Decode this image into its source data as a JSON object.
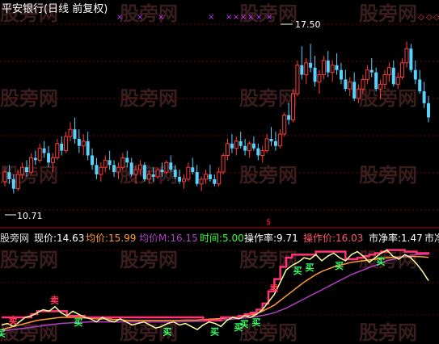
{
  "chart_data": [
    {
      "type": "candlestick",
      "title": "平安银行(日线 前复权)",
      "annotations": {
        "high_label": "17.50",
        "low_label": "10.71",
        "high_value": 17.5,
        "low_value": 10.71
      },
      "ylim": [
        10.3,
        18.6
      ],
      "top_markers": [
        "×",
        "×",
        "×",
        "×",
        "×",
        "×",
        "×",
        "×",
        "×",
        "×",
        "◇",
        "◇",
        "◇"
      ],
      "candles": [
        [
          11.7,
          12.3,
          11.5,
          12.1
        ],
        [
          12.1,
          12.4,
          11.6,
          11.8
        ],
        [
          11.8,
          12.0,
          11.2,
          11.4
        ],
        [
          11.4,
          12.2,
          11.3,
          12.0
        ],
        [
          12.0,
          12.5,
          11.8,
          12.3
        ],
        [
          12.3,
          12.6,
          11.9,
          12.1
        ],
        [
          12.1,
          12.9,
          12.0,
          12.7
        ],
        [
          12.7,
          13.0,
          12.4,
          12.6
        ],
        [
          12.6,
          13.3,
          12.5,
          13.1
        ],
        [
          13.1,
          13.4,
          12.7,
          12.9
        ],
        [
          12.9,
          13.2,
          12.3,
          12.5
        ],
        [
          12.5,
          12.9,
          12.1,
          12.7
        ],
        [
          12.7,
          13.5,
          12.6,
          13.3
        ],
        [
          13.3,
          13.6,
          12.8,
          13.0
        ],
        [
          13.0,
          13.8,
          12.9,
          13.6
        ],
        [
          13.6,
          14.2,
          13.4,
          13.9
        ],
        [
          13.9,
          14.4,
          13.3,
          13.5
        ],
        [
          13.5,
          13.9,
          12.9,
          13.2
        ],
        [
          13.2,
          13.7,
          12.8,
          13.4
        ],
        [
          13.4,
          13.8,
          12.6,
          12.8
        ],
        [
          12.8,
          13.1,
          12.2,
          12.4
        ],
        [
          12.4,
          12.7,
          11.8,
          12.0
        ],
        [
          12.0,
          12.5,
          11.7,
          12.3
        ],
        [
          12.3,
          12.8,
          12.1,
          12.6
        ],
        [
          12.6,
          13.0,
          12.2,
          12.4
        ],
        [
          12.4,
          12.6,
          11.9,
          12.1
        ],
        [
          12.1,
          12.5,
          11.8,
          12.3
        ],
        [
          12.3,
          12.9,
          12.2,
          12.7
        ],
        [
          12.7,
          13.0,
          12.3,
          12.5
        ],
        [
          12.5,
          12.7,
          11.9,
          12.0
        ],
        [
          12.0,
          12.4,
          11.6,
          12.2
        ],
        [
          12.2,
          12.6,
          12.0,
          12.4
        ],
        [
          12.4,
          12.5,
          11.7,
          11.8
        ],
        [
          11.8,
          12.2,
          11.6,
          12.0
        ],
        [
          12.0,
          12.3,
          11.7,
          11.9
        ],
        [
          11.9,
          12.3,
          11.8,
          12.2
        ],
        [
          12.2,
          12.5,
          11.9,
          12.1
        ],
        [
          12.1,
          12.6,
          12.0,
          12.5
        ],
        [
          12.5,
          12.8,
          12.1,
          12.2
        ],
        [
          12.2,
          12.4,
          11.8,
          11.9
        ],
        [
          11.9,
          12.2,
          11.6,
          11.7
        ],
        [
          11.7,
          12.0,
          11.4,
          11.8
        ],
        [
          11.8,
          12.5,
          11.7,
          12.3
        ],
        [
          12.3,
          12.7,
          12.0,
          12.1
        ],
        [
          12.1,
          12.4,
          11.5,
          11.6
        ],
        [
          11.6,
          11.9,
          11.3,
          11.8
        ],
        [
          11.8,
          12.2,
          11.6,
          12.0
        ],
        [
          12.0,
          12.4,
          11.7,
          11.8
        ],
        [
          11.8,
          12.0,
          11.5,
          11.6
        ],
        [
          11.6,
          12.3,
          11.5,
          12.1
        ],
        [
          12.1,
          12.9,
          12.0,
          12.8
        ],
        [
          12.8,
          13.5,
          12.6,
          13.3
        ],
        [
          13.3,
          13.7,
          12.9,
          13.1
        ],
        [
          13.1,
          13.6,
          12.8,
          13.4
        ],
        [
          13.4,
          13.8,
          13.1,
          13.2
        ],
        [
          13.2,
          13.5,
          12.8,
          13.0
        ],
        [
          13.0,
          13.4,
          12.7,
          13.3
        ],
        [
          13.3,
          13.6,
          13.0,
          13.1
        ],
        [
          13.1,
          13.3,
          12.6,
          12.8
        ],
        [
          12.8,
          13.2,
          12.5,
          13.0
        ],
        [
          13.0,
          13.7,
          12.9,
          13.5
        ],
        [
          13.5,
          14.0,
          13.2,
          13.4
        ],
        [
          13.4,
          13.8,
          13.0,
          13.2
        ],
        [
          13.2,
          13.9,
          13.1,
          13.7
        ],
        [
          13.7,
          14.6,
          13.6,
          14.5
        ],
        [
          14.5,
          15.0,
          14.1,
          14.3
        ],
        [
          14.3,
          15.6,
          14.2,
          15.4
        ],
        [
          15.4,
          16.8,
          15.3,
          16.6
        ],
        [
          16.6,
          17.4,
          16.0,
          16.2
        ],
        [
          16.2,
          16.9,
          15.8,
          16.7
        ],
        [
          16.7,
          17.5,
          16.3,
          16.5
        ],
        [
          16.5,
          17.0,
          15.7,
          15.9
        ],
        [
          15.9,
          16.4,
          15.4,
          16.2
        ],
        [
          16.2,
          17.0,
          16.0,
          16.8
        ],
        [
          16.8,
          17.2,
          16.1,
          16.3
        ],
        [
          16.3,
          16.8,
          15.9,
          16.6
        ],
        [
          16.6,
          17.1,
          16.2,
          16.4
        ],
        [
          16.4,
          16.7,
          15.8,
          16.0
        ],
        [
          16.0,
          16.4,
          15.5,
          15.6
        ],
        [
          15.6,
          16.1,
          15.3,
          15.9
        ],
        [
          15.9,
          16.3,
          15.1,
          15.2
        ],
        [
          15.2,
          15.8,
          15.0,
          15.6
        ],
        [
          15.6,
          16.2,
          15.4,
          16.0
        ],
        [
          16.0,
          16.6,
          15.8,
          16.4
        ],
        [
          16.4,
          16.9,
          16.1,
          16.3
        ],
        [
          16.3,
          16.5,
          15.5,
          15.6
        ],
        [
          15.6,
          16.0,
          15.2,
          15.8
        ],
        [
          15.8,
          16.4,
          15.6,
          16.2
        ],
        [
          16.2,
          16.7,
          15.9,
          16.5
        ],
        [
          16.5,
          16.8,
          15.7,
          15.8
        ],
        [
          15.8,
          16.3,
          15.6,
          16.1
        ],
        [
          16.1,
          16.9,
          16.0,
          16.7
        ],
        [
          16.7,
          17.6,
          16.5,
          17.3
        ],
        [
          17.3,
          17.5,
          16.3,
          16.4
        ],
        [
          16.4,
          16.8,
          15.8,
          16.0
        ],
        [
          16.0,
          16.4,
          15.4,
          15.5
        ],
        [
          15.5,
          15.9,
          14.8,
          15.0
        ],
        [
          15.0,
          15.3,
          14.2,
          14.4
        ]
      ]
    },
    {
      "type": "line",
      "ylim": [
        12.0,
        17.6
      ],
      "legend": [
        {
          "label": "股旁网",
          "value": "",
          "color": "#e0e0e0"
        },
        {
          "label": "现价:",
          "value": "14.63",
          "color": "#ffffff"
        },
        {
          "label": "均价:",
          "value": "15.99",
          "color": "#ff9a33"
        },
        {
          "label": "均价M:",
          "value": "16.15",
          "color": "#b040c0"
        },
        {
          "label": "时间:",
          "value": "5.00",
          "color": "#33ff33"
        },
        {
          "label": "操作率:",
          "value": "9.71",
          "color": "#ffffff"
        },
        {
          "label": "操作价:",
          "value": "16.03",
          "color": "#ff5566"
        },
        {
          "label": "市净率:",
          "value": "1.47",
          "color": "#ffffff"
        },
        {
          "label": "市净",
          "value": "",
          "color": "#ffffff"
        }
      ],
      "series": [
        {
          "name": "现价",
          "color": "#ffff99",
          "values": [
            12.4,
            12.5,
            12.3,
            12.6,
            12.9,
            13.0,
            13.2,
            13.4,
            13.3,
            13.6,
            13.2,
            13.0,
            13.3,
            13.1,
            12.9,
            12.8,
            12.6,
            12.9,
            12.7,
            12.6,
            12.8,
            12.6,
            12.4,
            12.5,
            12.6,
            12.4,
            12.2,
            12.3,
            12.5,
            12.6,
            12.4,
            12.5,
            12.3,
            12.1,
            12.4,
            12.6,
            12.5,
            12.3,
            12.7,
            12.9,
            12.8,
            13.0,
            12.9,
            13.1,
            13.4,
            13.9,
            14.4,
            15.2,
            16.0,
            16.3,
            16.5,
            16.8,
            16.7,
            17.0,
            16.6,
            16.9,
            17.1,
            16.8,
            16.6,
            17.0,
            17.2,
            16.9,
            16.5,
            16.8,
            17.1,
            17.3,
            16.9,
            16.7,
            17.0,
            16.8,
            16.4,
            15.9,
            15.3
          ]
        },
        {
          "name": "均价",
          "color": "#ff9a33",
          "values": [
            12.1,
            12.2,
            12.3,
            12.4,
            12.5,
            12.6,
            12.7,
            12.75,
            12.8,
            12.85,
            12.9,
            12.9,
            12.9,
            12.9,
            12.85,
            12.85,
            12.8,
            12.8,
            12.8,
            12.75,
            12.75,
            12.7,
            12.7,
            12.7,
            12.7,
            12.7,
            12.7,
            12.7,
            12.7,
            12.7,
            12.7,
            12.72,
            12.72,
            12.72,
            12.75,
            12.78,
            12.8,
            12.82,
            12.85,
            12.9,
            12.95,
            13.0,
            13.05,
            13.15,
            13.3,
            13.5,
            13.7,
            14.0,
            14.3,
            14.6,
            14.9,
            15.2,
            15.45,
            15.7,
            15.9,
            16.05,
            16.2,
            16.3,
            16.4,
            16.5,
            16.55,
            16.6,
            16.65,
            16.7,
            16.75,
            16.8,
            16.82,
            16.85,
            16.87,
            16.88,
            16.88,
            16.86,
            16.82
          ]
        },
        {
          "name": "均价M",
          "color": "#b040c0",
          "values": [
            12.0,
            12.05,
            12.1,
            12.15,
            12.2,
            12.25,
            12.3,
            12.35,
            12.4,
            12.45,
            12.5,
            12.52,
            12.55,
            12.57,
            12.58,
            12.6,
            12.6,
            12.6,
            12.6,
            12.6,
            12.6,
            12.6,
            12.6,
            12.6,
            12.6,
            12.6,
            12.6,
            12.6,
            12.6,
            12.6,
            12.6,
            12.62,
            12.63,
            12.64,
            12.65,
            12.67,
            12.7,
            12.72,
            12.75,
            12.78,
            12.82,
            12.86,
            12.9,
            12.95,
            13.02,
            13.1,
            13.2,
            13.35,
            13.5,
            13.7,
            13.9,
            14.1,
            14.3,
            14.5,
            14.7,
            14.9,
            15.1,
            15.3,
            15.5,
            15.7,
            15.85,
            16.0,
            16.15,
            16.3,
            16.45,
            16.6,
            16.7,
            16.8,
            16.88,
            16.95,
            17.0,
            17.02,
            17.03
          ]
        },
        {
          "name": "操作价",
          "color": "#ff3377",
          "values": [
            12.9,
            12.9,
            12.9,
            12.9,
            12.9,
            13.1,
            13.3,
            13.3,
            13.3,
            13.3,
            13.3,
            13.0,
            13.0,
            13.0,
            12.9,
            12.9,
            12.9,
            12.9,
            12.9,
            12.9,
            12.9,
            12.9,
            12.9,
            12.9,
            12.9,
            12.9,
            12.9,
            12.9,
            12.9,
            12.9,
            12.9,
            12.9,
            12.9,
            12.9,
            12.7,
            12.7,
            12.7,
            12.9,
            12.9,
            12.9,
            13.0,
            13.1,
            13.2,
            13.4,
            13.8,
            14.6,
            15.4,
            16.2,
            16.8,
            17.0,
            17.0,
            17.0,
            17.0,
            17.2,
            17.2,
            17.2,
            17.2,
            17.2,
            16.7,
            16.7,
            16.8,
            16.9,
            17.0,
            17.1,
            17.2,
            17.3,
            17.3,
            17.3,
            17.2,
            17.2,
            17.1,
            17.1,
            17.0
          ]
        }
      ],
      "signals": {
        "buy_label": "买",
        "sell_label": "卖",
        "sell_top_label": "卖",
        "buy_indices": [
          0,
          13,
          28,
          36,
          40,
          41,
          43,
          50,
          52,
          57,
          64
        ],
        "sell_indices": [
          2,
          9,
          46
        ]
      }
    }
  ],
  "watermark": "股旁网"
}
